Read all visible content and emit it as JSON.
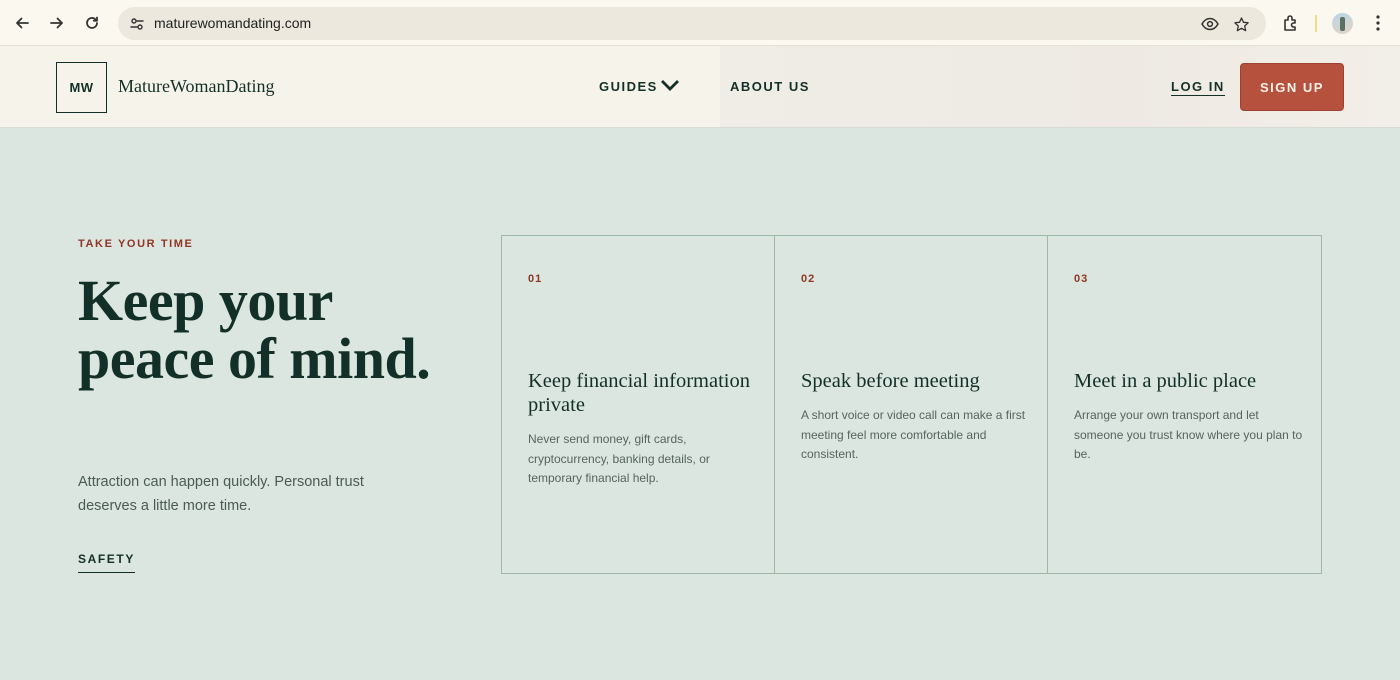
{
  "browser": {
    "url": "maturewomandating.com",
    "icons": [
      "back-arrow-icon",
      "forward-arrow-icon",
      "reload-icon",
      "site-info-icon",
      "eye-icon",
      "star-icon",
      "extensions-icon",
      "profile-avatar",
      "more-menu-icon"
    ]
  },
  "header": {
    "logo_mark": "MW",
    "logo_text": "MatureWomanDating",
    "nav": {
      "guides": "GUIDES",
      "about": "ABOUT US"
    },
    "login": "LOG IN",
    "signup": "SIGN UP",
    "colors": {
      "signup_bg": "#b5513d",
      "ink": "#123028"
    }
  },
  "hero": {
    "eyebrow": "TAKE YOUR TIME",
    "title": "Keep your peace of mind.",
    "subtitle": "Attraction can happen quickly. Personal trust deserves a little more time.",
    "link": "SAFETY",
    "colors": {
      "background": "#dce6e0",
      "accent": "#8f3523"
    }
  },
  "cards": [
    {
      "num": "01",
      "title": "Keep financial information private",
      "body": "Never send money, gift cards, cryptocurrency, banking details, or temporary financial help."
    },
    {
      "num": "02",
      "title": "Speak before meeting",
      "body": "A short voice or video call can make a first meeting feel more comfortable and consistent."
    },
    {
      "num": "03",
      "title": "Meet in a public place",
      "body": "Arrange your own transport and let someone you trust know where you plan to be."
    }
  ]
}
